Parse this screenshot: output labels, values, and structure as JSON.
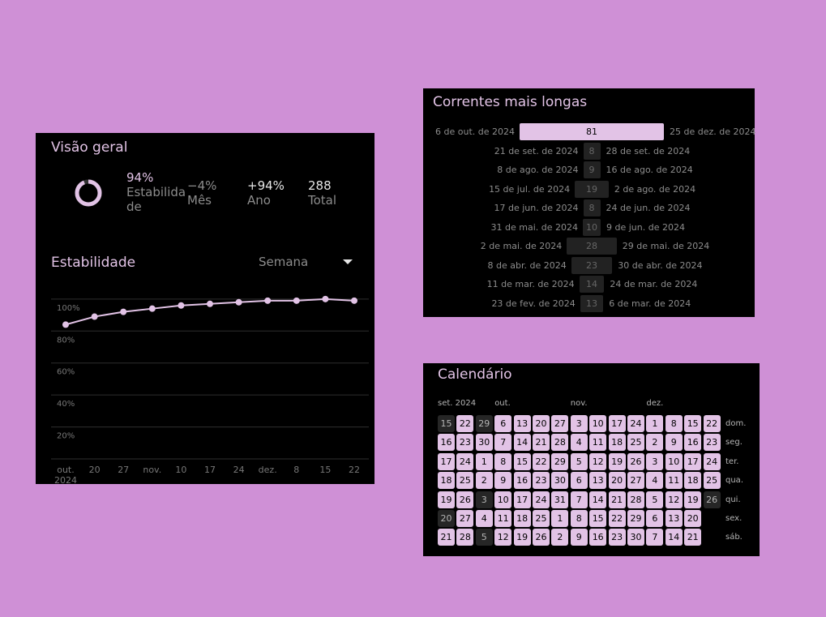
{
  "overview": {
    "title": "Visão geral",
    "stats": {
      "stability_value": "94%",
      "stability_label": "Estabilida de",
      "month_value": "−4%",
      "month_label": "Mês",
      "year_value": "+94%",
      "year_label": "Ano",
      "total_value": "288",
      "total_label": "Total"
    },
    "ring_fraction": 0.94,
    "section_title": "Estabilidade",
    "range_selector": "Semana",
    "accent_color": "#e2c3e6"
  },
  "chart_data": {
    "type": "line",
    "title": "",
    "xlabel": "",
    "ylabel": "",
    "x": [
      "out. 2024",
      "20",
      "27",
      "nov.",
      "10",
      "17",
      "24",
      "dez.",
      "8",
      "15",
      "22"
    ],
    "y_tick_labels": [
      "100%",
      "80%",
      "60%",
      "40%",
      "20%"
    ],
    "ylim": [
      0,
      105
    ],
    "grid": true,
    "series": [
      {
        "values": [
          84,
          89,
          92,
          94,
          96,
          97,
          98,
          99,
          99,
          100,
          99
        ]
      }
    ]
  },
  "streaks": {
    "title": "Correntes mais longas",
    "rows": [
      {
        "start": "6 de out. de 2024",
        "count": "81",
        "end": "25 de dez. de 2024"
      },
      {
        "start": "21 de set. de 2024",
        "count": "8",
        "end": "28 de set. de 2024"
      },
      {
        "start": "8 de ago. de 2024",
        "count": "9",
        "end": "16 de ago. de 2024"
      },
      {
        "start": "15 de jul. de 2024",
        "count": "19",
        "end": "2 de ago. de 2024"
      },
      {
        "start": "17 de jun. de 2024",
        "count": "8",
        "end": "24 de jun. de 2024"
      },
      {
        "start": "31 de mai. de 2024",
        "count": "10",
        "end": "9 de jun. de 2024"
      },
      {
        "start": "2 de mai. de 2024",
        "count": "28",
        "end": "29 de mai. de 2024"
      },
      {
        "start": "8 de abr. de 2024",
        "count": "23",
        "end": "30 de abr. de 2024"
      },
      {
        "start": "11 de mar. de 2024",
        "count": "14",
        "end": "24 de mar. de 2024"
      },
      {
        "start": "23 de fev. de 2024",
        "count": "13",
        "end": "6 de mar. de 2024"
      }
    ]
  },
  "calendar": {
    "title": "Calendário",
    "months": [
      "set. 2024",
      "out.",
      "nov.",
      "dez."
    ],
    "weekdays": [
      "dom.",
      "seg.",
      "ter.",
      "qua.",
      "qui.",
      "sex.",
      "sáb."
    ],
    "columns": [
      [
        "15",
        "16",
        "17",
        "18",
        "19",
        "20",
        "21"
      ],
      [
        "22",
        "23",
        "24",
        "25",
        "26",
        "27",
        "28"
      ],
      [
        "29",
        "30",
        "1",
        "2",
        "3",
        "4",
        "5"
      ],
      [
        "6",
        "7",
        "8",
        "9",
        "10",
        "11",
        "12"
      ],
      [
        "13",
        "14",
        "15",
        "16",
        "17",
        "18",
        "19"
      ],
      [
        "20",
        "21",
        "22",
        "23",
        "24",
        "25",
        "26"
      ],
      [
        "27",
        "28",
        "29",
        "30",
        "31",
        "1",
        "2"
      ],
      [
        "3",
        "4",
        "5",
        "6",
        "7",
        "8",
        "9"
      ],
      [
        "10",
        "11",
        "12",
        "13",
        "14",
        "15",
        "16"
      ],
      [
        "17",
        "18",
        "19",
        "20",
        "21",
        "22",
        "23"
      ],
      [
        "24",
        "25",
        "26",
        "27",
        "28",
        "29",
        "30"
      ],
      [
        "1",
        "2",
        "3",
        "4",
        "5",
        "6",
        "7"
      ],
      [
        "8",
        "9",
        "10",
        "11",
        "12",
        "13",
        "14"
      ],
      [
        "15",
        "16",
        "17",
        "18",
        "19",
        "20",
        "21"
      ],
      [
        "22",
        "23",
        "24",
        "25",
        "26",
        "",
        ""
      ]
    ],
    "completed": [
      [
        false,
        true,
        true,
        true,
        true,
        false,
        true
      ],
      [
        true,
        true,
        true,
        true,
        true,
        true,
        true
      ],
      [
        false,
        true,
        true,
        true,
        false,
        true,
        false
      ],
      [
        true,
        true,
        true,
        true,
        true,
        true,
        true
      ],
      [
        true,
        true,
        true,
        true,
        true,
        true,
        true
      ],
      [
        true,
        true,
        true,
        true,
        true,
        true,
        true
      ],
      [
        true,
        true,
        true,
        true,
        true,
        true,
        true
      ],
      [
        true,
        true,
        true,
        true,
        true,
        true,
        true
      ],
      [
        true,
        true,
        true,
        true,
        true,
        true,
        true
      ],
      [
        true,
        true,
        true,
        true,
        true,
        true,
        true
      ],
      [
        true,
        true,
        true,
        true,
        true,
        true,
        true
      ],
      [
        true,
        true,
        true,
        true,
        true,
        true,
        true
      ],
      [
        true,
        true,
        true,
        true,
        true,
        true,
        true
      ],
      [
        true,
        true,
        true,
        true,
        true,
        true,
        true
      ],
      [
        true,
        true,
        true,
        true,
        false,
        false,
        false
      ]
    ]
  }
}
